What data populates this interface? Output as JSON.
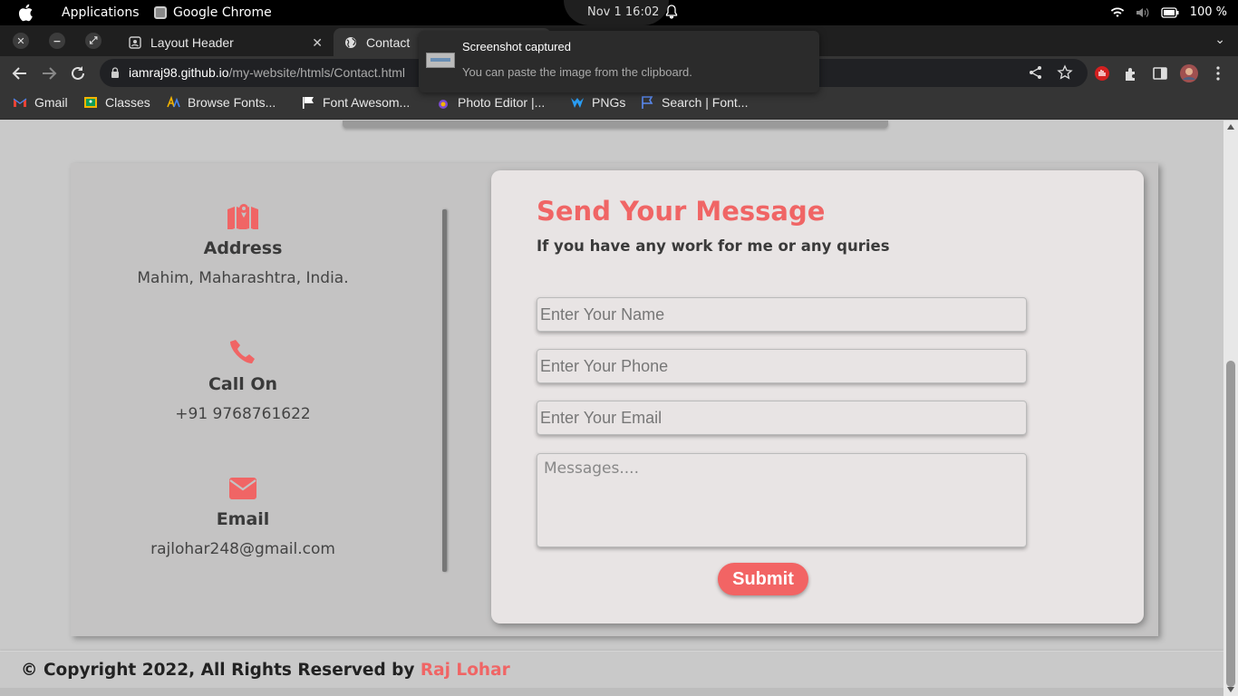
{
  "system_bar": {
    "applications": "Applications",
    "active_app": "Google Chrome",
    "clock": "Nov 1  16:02",
    "battery": "100 %"
  },
  "tabs": [
    {
      "label": "Layout Header",
      "icon": "page-icon"
    },
    {
      "label": "Contact",
      "icon": "globe-icon"
    }
  ],
  "address_bar": {
    "domain": "iamraj98.github.io",
    "path": "/my-website/htmls/Contact.html"
  },
  "bookmarks": [
    {
      "label": "Gmail",
      "icon": "gmail-icon"
    },
    {
      "label": "Classes",
      "icon": "classroom-icon"
    },
    {
      "label": "Browse Fonts...",
      "icon": "fonts-icon"
    },
    {
      "label": "Font Awesom...",
      "icon": "flag-icon"
    },
    {
      "label": "Photo Editor |...",
      "icon": "photo-icon"
    },
    {
      "label": "PNGs",
      "icon": "pngs-icon"
    },
    {
      "label": "Search | Font...",
      "icon": "flag-outline-icon"
    }
  ],
  "notification": {
    "title": "Screenshot captured",
    "body": "You can paste the image from the clipboard."
  },
  "contact_info": {
    "address": {
      "title": "Address",
      "value": "Mahim, Maharashtra, India.",
      "icon": "map-icon"
    },
    "phone": {
      "title": "Call On",
      "value": "+91 9768761622",
      "icon": "phone-icon"
    },
    "email": {
      "title": "Email",
      "value": "rajlohar248@gmail.com",
      "icon": "envelope-icon"
    }
  },
  "form": {
    "title": "Send Your Message",
    "subtitle": "If you have any work for me or any quries",
    "name_placeholder": "Enter Your Name",
    "phone_placeholder": "Enter Your Phone",
    "email_placeholder": "Enter Your Email",
    "message_placeholder": "Messages....",
    "submit_label": "Submit"
  },
  "footer": {
    "text": "© Copyright 2022, All Rights Reserved by ",
    "name": "Raj Lohar"
  },
  "colors": {
    "accent": "#f06565",
    "card_bg": "#e8e4e4",
    "page_bg": "#c9c9c9"
  }
}
